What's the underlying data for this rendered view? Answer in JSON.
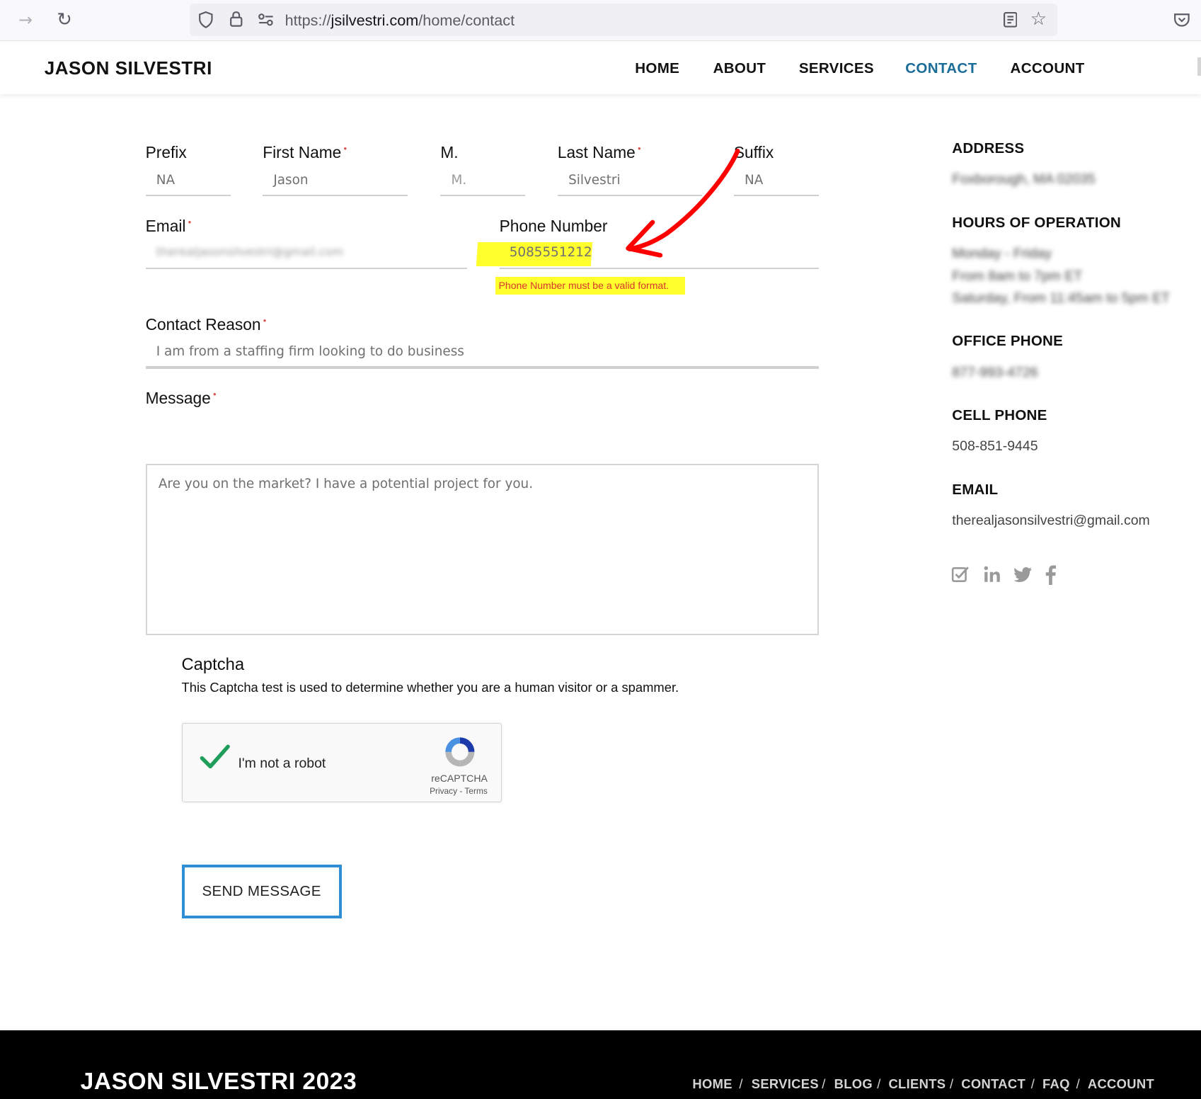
{
  "browser": {
    "url_prefix": "https://",
    "url_host": "jsilvestri.com",
    "url_path": "/home/contact"
  },
  "header": {
    "brand": "JASON SILVESTRI",
    "nav": [
      "HOME",
      "ABOUT",
      "SERVICES",
      "CONTACT",
      "ACCOUNT"
    ],
    "active": "CONTACT"
  },
  "form": {
    "prefix": {
      "label": "Prefix",
      "value": "NA"
    },
    "first_name": {
      "label": "First Name",
      "value": "Jason"
    },
    "middle": {
      "label": "M.",
      "placeholder": "M."
    },
    "last_name": {
      "label": "Last Name",
      "value": "Silvestri"
    },
    "suffix": {
      "label": "Suffix",
      "value": "NA"
    },
    "email": {
      "label": "Email",
      "value": "therealjasonsilvestri@gmail.com"
    },
    "phone": {
      "label": "Phone Number",
      "value": "5085551212",
      "error": "Phone Number must be a valid format."
    },
    "contact_reason": {
      "label": "Contact Reason",
      "value": "I am from a staffing firm looking to do business"
    },
    "message": {
      "label": "Message",
      "value": "Are you on the market? I have a potential project for you."
    },
    "captcha": {
      "title": "Captcha",
      "description": "This Captcha test is used to determine whether you are a human visitor or a spammer.",
      "checkbox_label": "I'm not a robot",
      "brand": "reCAPTCHA",
      "privacy": "Privacy",
      "separator": " - ",
      "terms": "Terms"
    },
    "submit": "SEND MESSAGE"
  },
  "sidebar": {
    "address": {
      "heading": "ADDRESS",
      "value": "Foxborough, MA 02035"
    },
    "hours": {
      "heading": "HOURS OF OPERATION",
      "lines": [
        "Monday - Friday",
        "From 8am to 7pm ET",
        "Saturday, From 11:45am to 5pm ET"
      ]
    },
    "office_phone": {
      "heading": "OFFICE PHONE",
      "value": "877-993-4726"
    },
    "cell_phone": {
      "heading": "CELL PHONE",
      "value": "508-851-9445"
    },
    "email": {
      "heading": "EMAIL",
      "value": "therealjasonsilvestri@gmail.com"
    },
    "socials": [
      "checkbox-icon",
      "linkedin-icon",
      "twitter-icon",
      "facebook-icon"
    ]
  },
  "footer": {
    "brand": "JASON SILVESTRI 2023",
    "nav": [
      "HOME",
      "SERVICES",
      "BLOG",
      "CLIENTS",
      "CONTACT",
      "FAQ",
      "ACCOUNT"
    ],
    "separator": "/"
  },
  "colors": {
    "accent": "#1b6d98",
    "button_border": "#2f8fd5",
    "highlight": "#ffff2e",
    "error": "#d9362e",
    "annotation": "#ff0000"
  }
}
